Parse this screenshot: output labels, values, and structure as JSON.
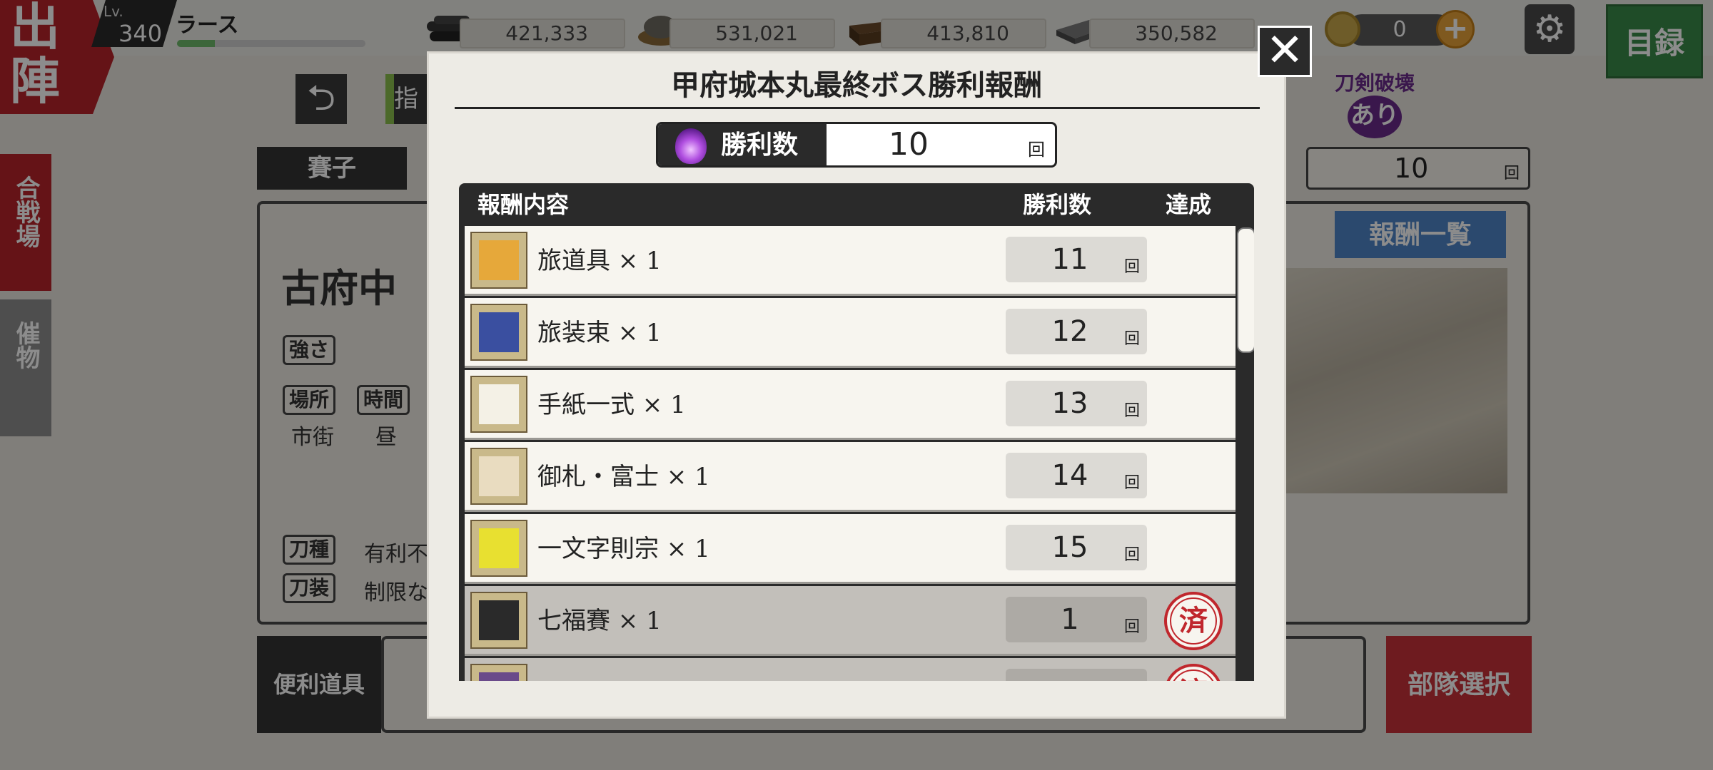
{
  "header": {
    "sortie_chars": [
      "出",
      "陣"
    ],
    "level_label": "Lv.",
    "level": "340",
    "player_name": "ラース",
    "exp_fraction": 0.2
  },
  "resources": [
    {
      "icon": "charcoal-icon",
      "value": "421,333"
    },
    {
      "icon": "whetstone-icon",
      "value": "531,021"
    },
    {
      "icon": "cooling-water-icon",
      "value": "413,810"
    },
    {
      "icon": "steel-icon",
      "value": "350,582"
    }
  ],
  "koban": {
    "value": "0",
    "plus": "+"
  },
  "catalog_label": "目録",
  "side_tabs": [
    {
      "label": "合戦場",
      "color": "#b8232b"
    },
    {
      "label": "催物",
      "color": "#8e8e8e"
    }
  ],
  "background": {
    "back_glyph": "⮌",
    "green_tab_label": "指",
    "dice_label": "賽子",
    "stage_name": "古府中",
    "strength_label": "強さ",
    "place_label": "場所",
    "time_label": "時間",
    "place_value": "市街",
    "time_value": "昼",
    "sword_type_label": "刀種",
    "sword_type_value": "有利不",
    "sword_equip_label": "刀装",
    "sword_equip_value": "制限な",
    "tool_label": "便利道具",
    "break_line1": "刀剣破壊",
    "break_line2": "あり",
    "wins_value": "10",
    "wins_unit": "回",
    "reward_list_label": "報酬一覧",
    "deploy_label": "部隊選択"
  },
  "modal": {
    "title": "甲府城本丸最終ボス勝利報酬",
    "close_glyph": "✕",
    "wins_label": "勝利数",
    "wins_value": "10",
    "wins_unit": "回",
    "columns": [
      "報酬内容",
      "勝利数",
      "達成"
    ],
    "stamp_text": "済",
    "rewards": [
      {
        "name": "旅道具 × 1",
        "wins": "11",
        "unit": "回",
        "done": false,
        "icon": "travel-tools-icon",
        "color": "#e6a83a"
      },
      {
        "name": "旅装束 × 1",
        "wins": "12",
        "unit": "回",
        "done": false,
        "icon": "travel-outfit-icon",
        "color": "#3a4fa0"
      },
      {
        "name": "手紙一式 × 1",
        "wins": "13",
        "unit": "回",
        "done": false,
        "icon": "letter-set-icon",
        "color": "#f4f1e6"
      },
      {
        "name": "御札・富士 × 1",
        "wins": "14",
        "unit": "回",
        "done": false,
        "icon": "talisman-fuji-icon",
        "color": "#e9dcc0"
      },
      {
        "name": "一文字則宗 × 1",
        "wins": "15",
        "unit": "回",
        "done": false,
        "icon": "sword-icon",
        "color": "#e8e030"
      },
      {
        "name": "七福賽 × 1",
        "wins": "1",
        "unit": "回",
        "done": true,
        "icon": "lucky-dice-icon",
        "color": "#2a2a2a"
      },
      {
        "name": "",
        "wins": "",
        "unit": "",
        "done": true,
        "icon": "reward-icon",
        "color": "#6a4a8a"
      }
    ]
  }
}
